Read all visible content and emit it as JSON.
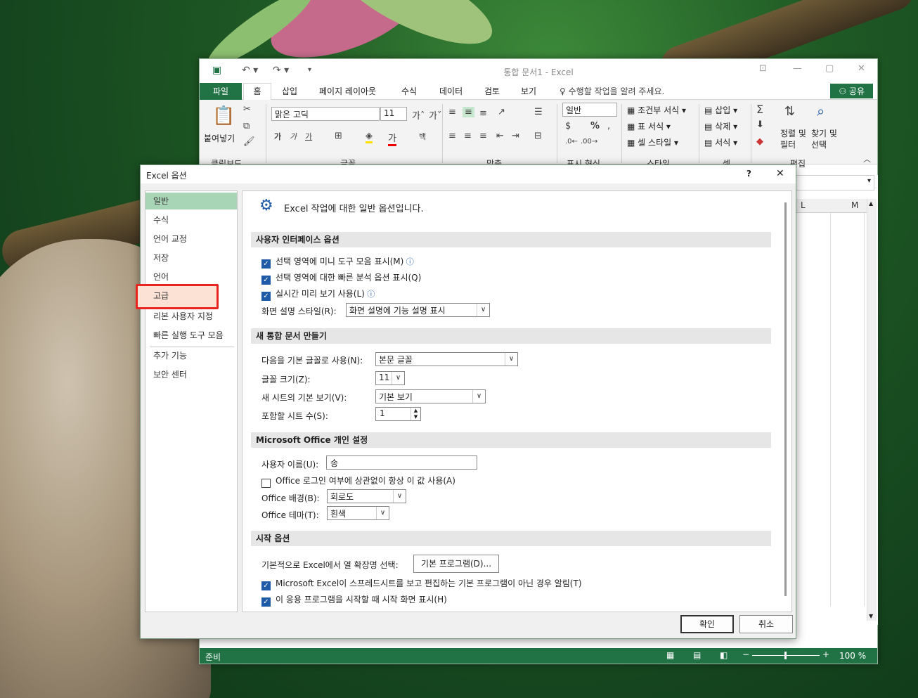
{
  "excel": {
    "doc_title": "통합 문서1 - Excel",
    "tabs": [
      "파일",
      "홈",
      "삽입",
      "페이지 레이아웃",
      "수식",
      "데이터",
      "검토",
      "보기"
    ],
    "tell_me": "수행할 작업을 알려 주세요.",
    "share": "공유",
    "ribbon": {
      "paste": "붙여넣기",
      "font_name": "맑은 고딕",
      "font_size": "11",
      "number_format": "일반",
      "cond_format": "조건부 서식",
      "table_format": "표 서식",
      "cell_style": "셀 스타일",
      "insert": "삽입",
      "delete": "삭제",
      "format": "서식",
      "sort_filter": "정렬 및 필터",
      "find_select": "찾기 및 선택",
      "groups": [
        "클립보드",
        "글꼴",
        "맞춤",
        "표시 형식",
        "스타일",
        "셀",
        "편집"
      ],
      "bold": "가",
      "italic": "가",
      "underline": "가"
    },
    "columns": [
      "L",
      "M"
    ],
    "status": "준비",
    "zoom": "100 %"
  },
  "dialog": {
    "title": "Excel 옵션",
    "help": "?",
    "close": "✕",
    "nav": [
      "일반",
      "수식",
      "언어 교정",
      "저장",
      "언어",
      "고급",
      "리본 사용자 지정",
      "빠른 실행 도구 모음",
      "추가 기능",
      "보안 센터"
    ],
    "header": "Excel 작업에 대한 일반 옵션입니다.",
    "sections": {
      "ui": "사용자 인터페이스 옵션",
      "new": "새 통합 문서 만들기",
      "personal": "Microsoft Office 개인 설정",
      "start": "시작 옵션"
    },
    "ui": {
      "mini_toolbar": "선택 영역에 미니 도구 모음 표시(M)",
      "quick_analysis": "선택 영역에 대한 빠른 분석 옵션 표시(Q)",
      "live_preview": "실시간 미리 보기 사용(L)",
      "tooltip_label": "화면 설명 스타일(R):",
      "tooltip_value": "화면 설명에 기능 설명 표시"
    },
    "new": {
      "font_label": "다음을 기본 글꼴로 사용(N):",
      "font_value": "본문 글꼴",
      "size_label": "글꼴 크기(Z):",
      "size_value": "11",
      "view_label": "새 시트의 기본 보기(V):",
      "view_value": "기본 보기",
      "sheets_label": "포함할 시트 수(S):",
      "sheets_value": "1"
    },
    "personal": {
      "user_label": "사용자 이름(U):",
      "user_value": "송",
      "always_use": "Office 로그인 여부에 상관없이 항상 이 값 사용(A)",
      "bg_label": "Office 배경(B):",
      "bg_value": "회로도",
      "theme_label": "Office 테마(T):",
      "theme_value": "흰색"
    },
    "start": {
      "ext_label": "기본적으로 Excel에서 열 확장명 선택:",
      "default_programs": "기본 프로그램(D)...",
      "notify_default": "Microsoft Excel이 스프레드시트를 보고 편집하는 기본 프로그램이 아닌 경우 알림(T)",
      "show_start": "이 응용 프로그램을 시작할 때 시작 화면 표시(H)"
    },
    "ok": "확인",
    "cancel": "취소"
  }
}
